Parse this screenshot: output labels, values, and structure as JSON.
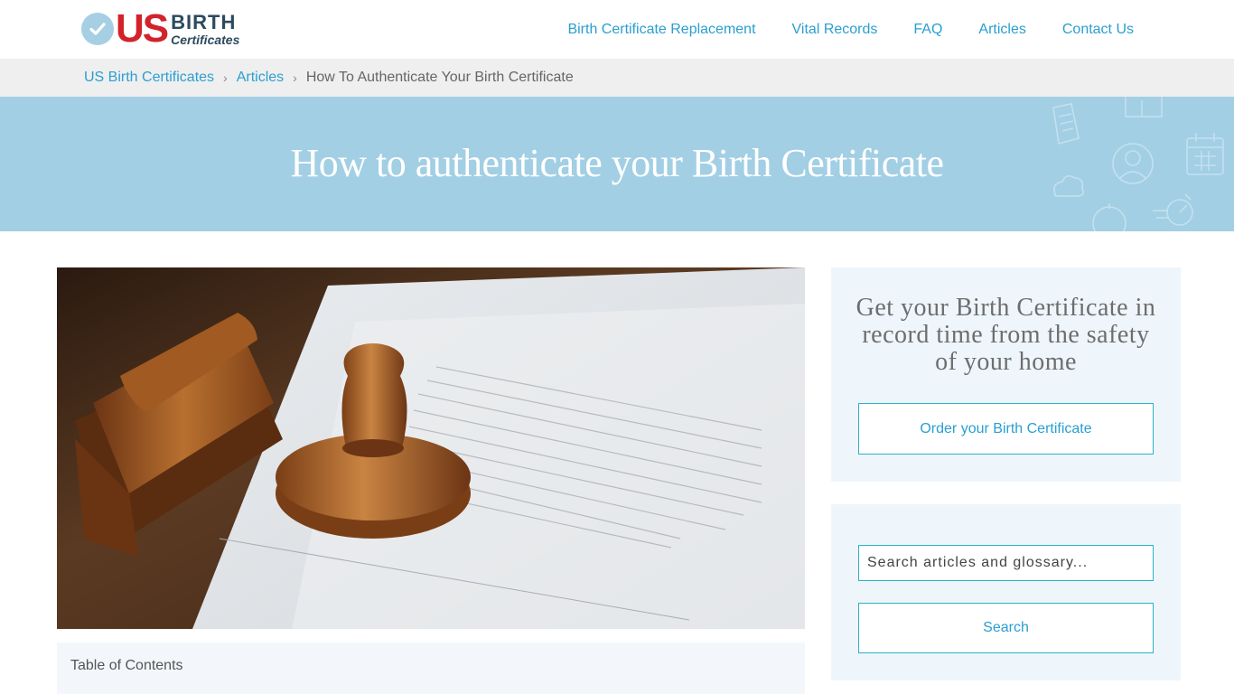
{
  "header": {
    "logo": {
      "us": "US",
      "birth": "BIRTH",
      "certificates": "Certificates",
      "colors": {
        "us": "#d2232a",
        "circle": "#a6cfe3",
        "text": "#2c4a5e"
      },
      "icon": "check-icon"
    },
    "nav": [
      {
        "label": "Birth Certificate Replacement"
      },
      {
        "label": "Vital Records"
      },
      {
        "label": "FAQ"
      },
      {
        "label": "Articles"
      },
      {
        "label": "Contact Us"
      }
    ]
  },
  "breadcrumb": {
    "items": [
      {
        "label": "US Birth Certificates"
      },
      {
        "label": "Articles"
      }
    ],
    "current": "How To Authenticate Your Birth Certificate",
    "separator": "›"
  },
  "hero": {
    "title": "How to authenticate your Birth Certificate",
    "background": "#a2cfe4"
  },
  "article": {
    "image_alt": "wooden rubber stamps on a document",
    "toc_title": "Table of Contents"
  },
  "sidebar": {
    "order_card": {
      "heading": "Get your Birth Certificate in record time from the safety of your home",
      "button_label": "Order your Birth Certificate"
    },
    "search_card": {
      "placeholder": "Search articles and glossary...",
      "button_label": "Search"
    }
  },
  "colors": {
    "link": "#2a9fd0",
    "button_border": "#2ab3c6",
    "card_bg": "#eef6fc"
  }
}
